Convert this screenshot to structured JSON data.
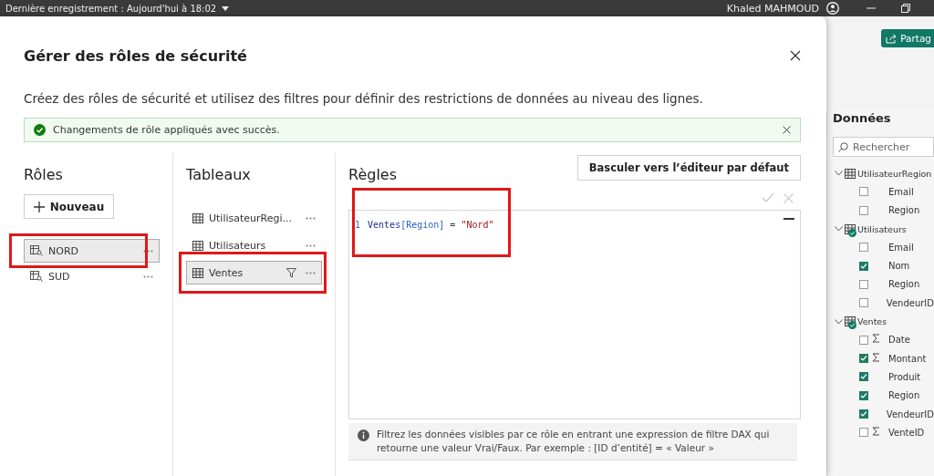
{
  "title_bar": {
    "save_status": "Dernière enregistrement : Aujourd'hui à 18:02",
    "user": "Khaled MAHMOUD"
  },
  "share_button": {
    "label": "Partag"
  },
  "dialog": {
    "title": "Gérer des rôles de sécurité",
    "description": "Créez des rôles de sécurité et utilisez des filtres pour définir des restrictions de données au niveau des lignes.",
    "banner": {
      "text": "Changements de rôle appliqués avec succès."
    },
    "roles": {
      "heading": "Rôles",
      "new_button": "Nouveau",
      "items": [
        {
          "label": "NORD",
          "selected": true,
          "highlighted": true
        },
        {
          "label": "SUD",
          "selected": false,
          "highlighted": false
        }
      ]
    },
    "tables": {
      "heading": "Tableaux",
      "items": [
        {
          "label": "UtilisateurRegi...",
          "selected": false,
          "filtered": false,
          "highlighted": false
        },
        {
          "label": "Utilisateurs",
          "selected": false,
          "filtered": false,
          "highlighted": false
        },
        {
          "label": "Ventes",
          "selected": true,
          "filtered": true,
          "highlighted": true
        }
      ]
    },
    "rules": {
      "heading": "Règles",
      "switch_button": "Basculer vers l’éditeur par défaut",
      "highlighted": true,
      "lines": [
        {
          "number": "1",
          "tokens": [
            {
              "kind": "table",
              "text": "Ventes"
            },
            {
              "kind": "column",
              "text": "[Region]"
            },
            {
              "kind": "operator",
              "text": " = "
            },
            {
              "kind": "string",
              "text": "\"Nord\""
            }
          ]
        }
      ],
      "hint": "Filtrez les données visibles par ce rôle en entrant une expression de filtre DAX qui retourne une valeur Vrai/Faux. Par exemple : [ID d’entité] = « Valeur »"
    }
  },
  "data_pane": {
    "title": "Données",
    "search": {
      "placeholder": "Rechercher"
    },
    "tables": [
      {
        "name": "UtilisateurRegion",
        "expanded": true,
        "used": false,
        "fields": [
          {
            "name": "Email",
            "checked": false,
            "kind": "plain"
          },
          {
            "name": "Region",
            "checked": false,
            "kind": "plain"
          }
        ]
      },
      {
        "name": "Utilisateurs",
        "expanded": true,
        "used": true,
        "fields": [
          {
            "name": "Email",
            "checked": false,
            "kind": "plain"
          },
          {
            "name": "Nom",
            "checked": true,
            "kind": "plain"
          },
          {
            "name": "Region",
            "checked": false,
            "kind": "plain"
          },
          {
            "name": "VendeurID",
            "checked": false,
            "kind": "plain"
          }
        ]
      },
      {
        "name": "Ventes",
        "expanded": true,
        "used": true,
        "fields": [
          {
            "name": "Date",
            "checked": false,
            "kind": "sum"
          },
          {
            "name": "Montant",
            "checked": true,
            "kind": "sum"
          },
          {
            "name": "Produit",
            "checked": true,
            "kind": "plain"
          },
          {
            "name": "Region",
            "checked": true,
            "kind": "plain"
          },
          {
            "name": "VendeurID",
            "checked": true,
            "kind": "plain"
          },
          {
            "name": "VenteID",
            "checked": false,
            "kind": "sum"
          }
        ]
      }
    ]
  }
}
